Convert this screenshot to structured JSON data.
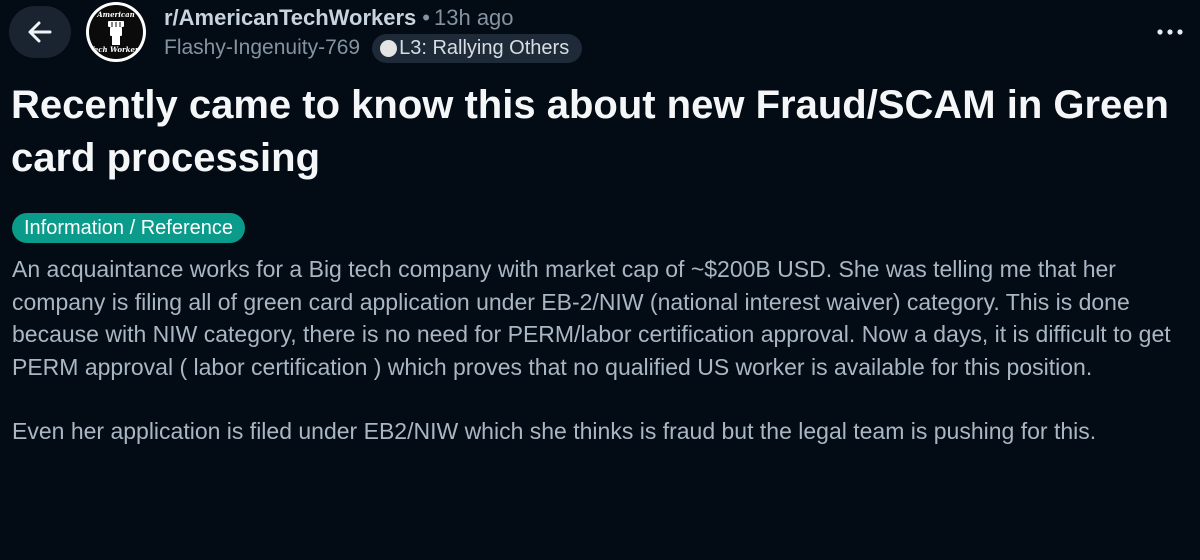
{
  "header": {
    "back_icon": "arrow-left-icon",
    "more_icon": "more-horizontal-icon",
    "subreddit": {
      "name": "r/AmericanTechWorkers",
      "separator": "•",
      "time_ago": "13h ago",
      "avatar_text_top": "American",
      "avatar_text_bottom": "Tech Workers"
    },
    "author": {
      "username": "Flashy-Ingenuity-769",
      "flair": "L3: Rallying Others"
    }
  },
  "post": {
    "title": "Recently came to know this about new Fraud/SCAM in Green card processing",
    "flair": "Information / Reference",
    "body": {
      "paragraph_1": "An acquaintance works for a Big tech company with market cap of ~$200B USD. She was telling me that her company is filing all of green card application under EB-2/NIW (national interest waiver) category. This is done because with NIW category, there is no need for PERM/labor certification approval. Now a days, it is difficult to get PERM approval ( labor certification ) which proves that no qualified US worker is available for this position.",
      "paragraph_2": "Even her application is filed under EB2/NIW which she thinks is fraud but the legal team is pushing for this."
    }
  },
  "colors": {
    "background": "#030b14",
    "flair_teal": "#0a9b8b",
    "muted_text": "#8493a1",
    "body_text": "#a9b7c4"
  }
}
